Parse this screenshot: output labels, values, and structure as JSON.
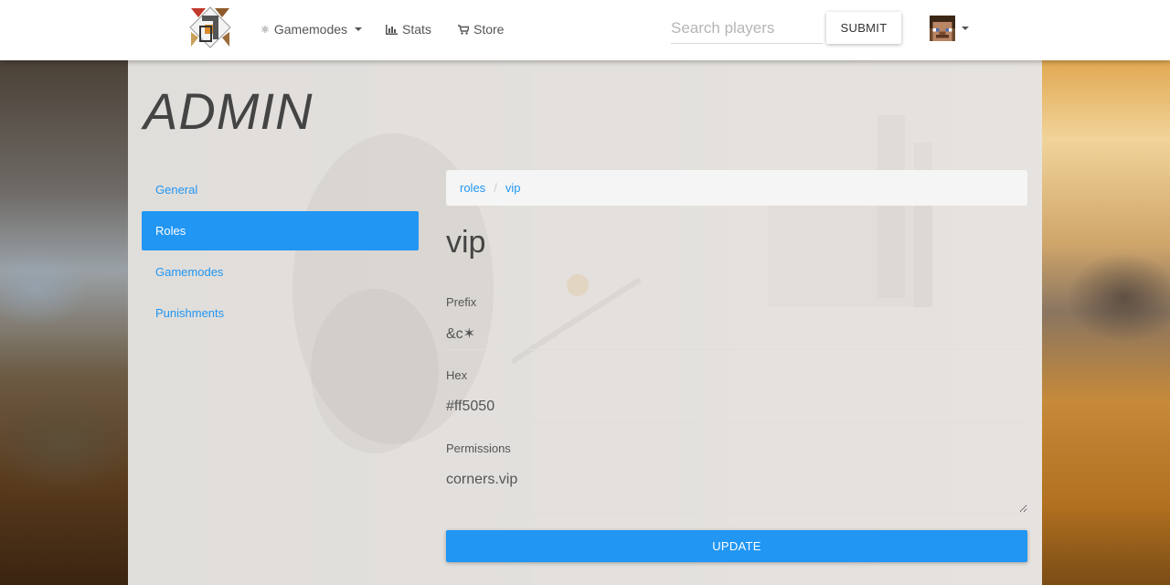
{
  "navbar": {
    "logo_alt": "Corners logo",
    "links": [
      {
        "label": "Gamemodes",
        "icon": "gamepad-icon",
        "dropdown": true
      },
      {
        "label": "Stats",
        "icon": "bar-chart-icon",
        "dropdown": false
      },
      {
        "label": "Store",
        "icon": "shopping-cart-icon",
        "dropdown": false
      }
    ],
    "search_placeholder": "Search players",
    "submit_label": "SUBMIT",
    "avatar_icon": "player-head-icon"
  },
  "page": {
    "title": "ADMIN"
  },
  "sidebar": {
    "items": [
      {
        "label": "General",
        "active": false
      },
      {
        "label": "Roles",
        "active": true
      },
      {
        "label": "Gamemodes",
        "active": false
      },
      {
        "label": "Punishments",
        "active": false
      }
    ]
  },
  "breadcrumb": {
    "items": [
      "roles",
      "vip"
    ],
    "separator": "/"
  },
  "role": {
    "name": "vip",
    "prefix_label": "Prefix",
    "prefix_value": "&c✶",
    "hex_label": "Hex",
    "hex_value": "#ff5050",
    "permissions_label": "Permissions",
    "permissions_value": "corners.vip",
    "update_label": "UPDATE"
  },
  "colors": {
    "accent": "#2196f3",
    "navbar_bg": "#ffffff",
    "panel_bg": "#eeecea"
  }
}
